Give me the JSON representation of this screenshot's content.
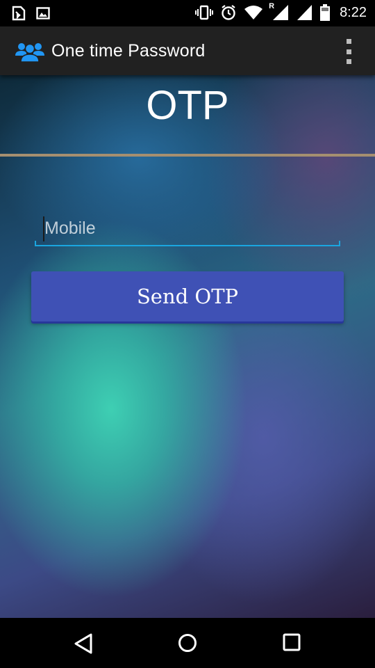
{
  "status_bar": {
    "time": "8:22",
    "left_icons": [
      "sim-toolkit-icon",
      "image-icon"
    ],
    "right_icons": [
      "vibrate-icon",
      "alarm-icon",
      "wifi-icon",
      "signal-roaming-icon",
      "battery-icon"
    ],
    "roaming_label": "R"
  },
  "app_bar": {
    "title": "One time Password",
    "logo_icon": "users-group-icon",
    "logo_color": "#2196f3",
    "menu_icon": "overflow-menu-icon"
  },
  "main": {
    "heading": "OTP",
    "mobile_input": {
      "placeholder": "Mobile",
      "value": ""
    },
    "send_button_label": "Send OTP",
    "accent_color": "#3f51b5",
    "divider_color": "#a58f70"
  },
  "nav_bar": {
    "back_icon": "back-triangle-icon",
    "home_icon": "home-circle-icon",
    "recents_icon": "recents-square-icon"
  }
}
